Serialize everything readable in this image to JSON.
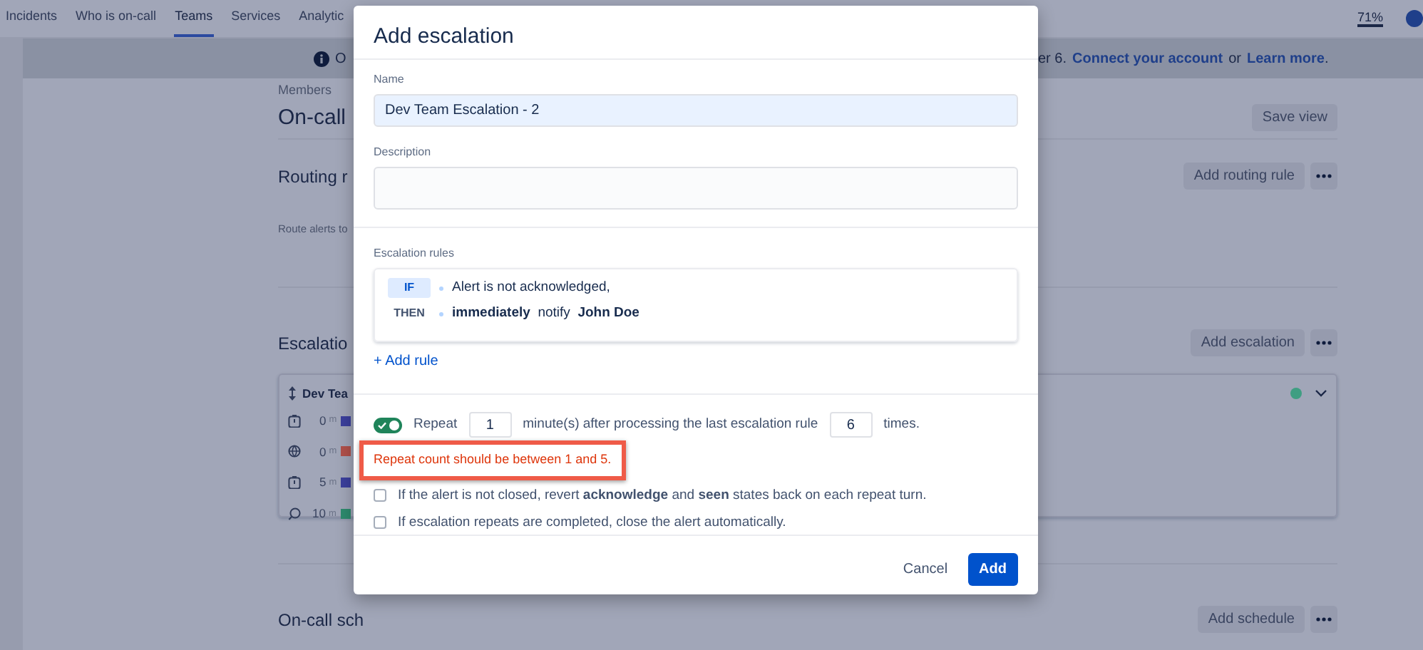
{
  "nav": {
    "tabs": [
      {
        "label": "Incidents",
        "selected": false
      },
      {
        "label": "Who is on-call",
        "selected": false
      },
      {
        "label": "Teams",
        "selected": true
      },
      {
        "label": "Services",
        "selected": false
      },
      {
        "label": "Analytic",
        "selected": false
      }
    ],
    "zoom": "71%"
  },
  "banner": {
    "text_start": "O",
    "text_end": "er 6.",
    "links": [
      "Connect your account",
      "Learn more"
    ],
    "joiner": "or",
    "end": "."
  },
  "page": {
    "breadcrumb": "Members",
    "title": "On-call",
    "save_button": "Save view",
    "sections": [
      {
        "title": "Routing r",
        "button": "Add routing rule",
        "description": "Route alerts to"
      },
      {
        "title": "Escalatio",
        "button": "Add escalation",
        "card": {
          "title": "Dev Tea",
          "color": "#3f9e82",
          "expanded": false,
          "rows": [
            {
              "kind": "timer",
              "time": "0",
              "unit": "m",
              "color": "#3b3f9c"
            },
            {
              "kind": "globe",
              "time": "0",
              "unit": "m",
              "color": "#b0504a"
            },
            {
              "kind": "timer",
              "time": "5",
              "unit": "m",
              "color": "#3b3f9c"
            },
            {
              "kind": "chat",
              "time": "10",
              "unit": "m",
              "color": "#2e8a6e"
            }
          ]
        }
      },
      {
        "title": "On-call sch",
        "button": "Add schedule"
      }
    ]
  },
  "modal": {
    "title": "Add escalation",
    "name_label": "Name",
    "name_value": "Dev Team Escalation - 2",
    "description_label": "Description",
    "rules_label": "Escalation rules",
    "rules": [
      {
        "keyword": "IF",
        "text": "Alert is not acknowledged,",
        "highlighted": true
      },
      {
        "keyword": "THEN",
        "text": "**immediately**  notify  **John Doe**",
        "highlighted": false
      }
    ],
    "add_rule": "+ Add rule",
    "repeat": {
      "on": true,
      "label": "Repeat",
      "minutes": "1",
      "middle": "minute(s) after processing the last escalation rule",
      "count": "6",
      "end": "times."
    },
    "error": {
      "text": "Repeat count should be between 1 and 5.",
      "highlighted": true
    },
    "options": [
      {
        "text": "If the alert is not closed, revert **acknowledge** and **seen** states back on each repeat turn.",
        "checked": false
      },
      {
        "text": "If escalation repeats are completed, close the alert automatically.",
        "checked": false
      }
    ],
    "buttons": {
      "cancel": "Cancel",
      "submit": "Add"
    }
  }
}
